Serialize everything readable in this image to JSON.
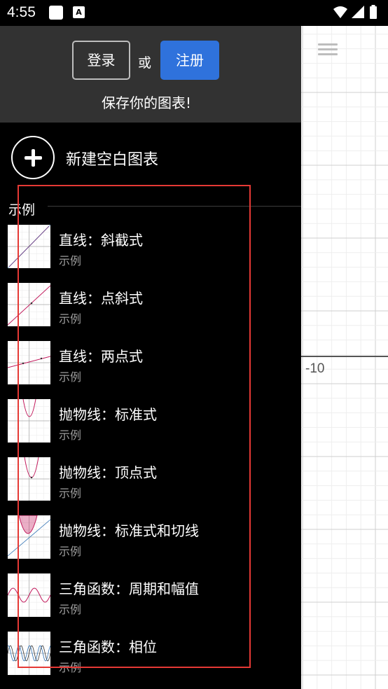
{
  "status_bar": {
    "time": "4:55",
    "notif_a": "A",
    "icons": [
      "notification-square-icon",
      "notification-a-icon",
      "wifi-icon",
      "cellular-signal-icon",
      "battery-icon"
    ]
  },
  "header": {
    "login_label": "登录",
    "or_label": "或",
    "register_label": "注册",
    "save_prompt": "保存你的图表!"
  },
  "new_graph": {
    "label": "新建空白图表"
  },
  "examples": {
    "section_title": "示例",
    "items": [
      {
        "title": "直线：斜截式",
        "subtitle": "示例"
      },
      {
        "title": "直线：点斜式",
        "subtitle": "示例"
      },
      {
        "title": "直线：两点式",
        "subtitle": "示例"
      },
      {
        "title": "抛物线：标准式",
        "subtitle": "示例"
      },
      {
        "title": "抛物线：顶点式",
        "subtitle": "示例"
      },
      {
        "title": "抛物线：标准式和切线",
        "subtitle": "示例"
      },
      {
        "title": "三角函数：周期和幅值",
        "subtitle": "示例"
      },
      {
        "title": "三角函数：相位",
        "subtitle": "示例"
      }
    ]
  },
  "graph": {
    "axis_tick_label": "-10"
  },
  "colors": {
    "header_bg": "#323232",
    "register_bg": "#2f72dc",
    "highlight": "#e53935",
    "grid_minor": "#eeeeee",
    "grid_major": "#cfcfcf",
    "curve_red": "#c2185b",
    "curve_blue": "#2d70b3"
  }
}
